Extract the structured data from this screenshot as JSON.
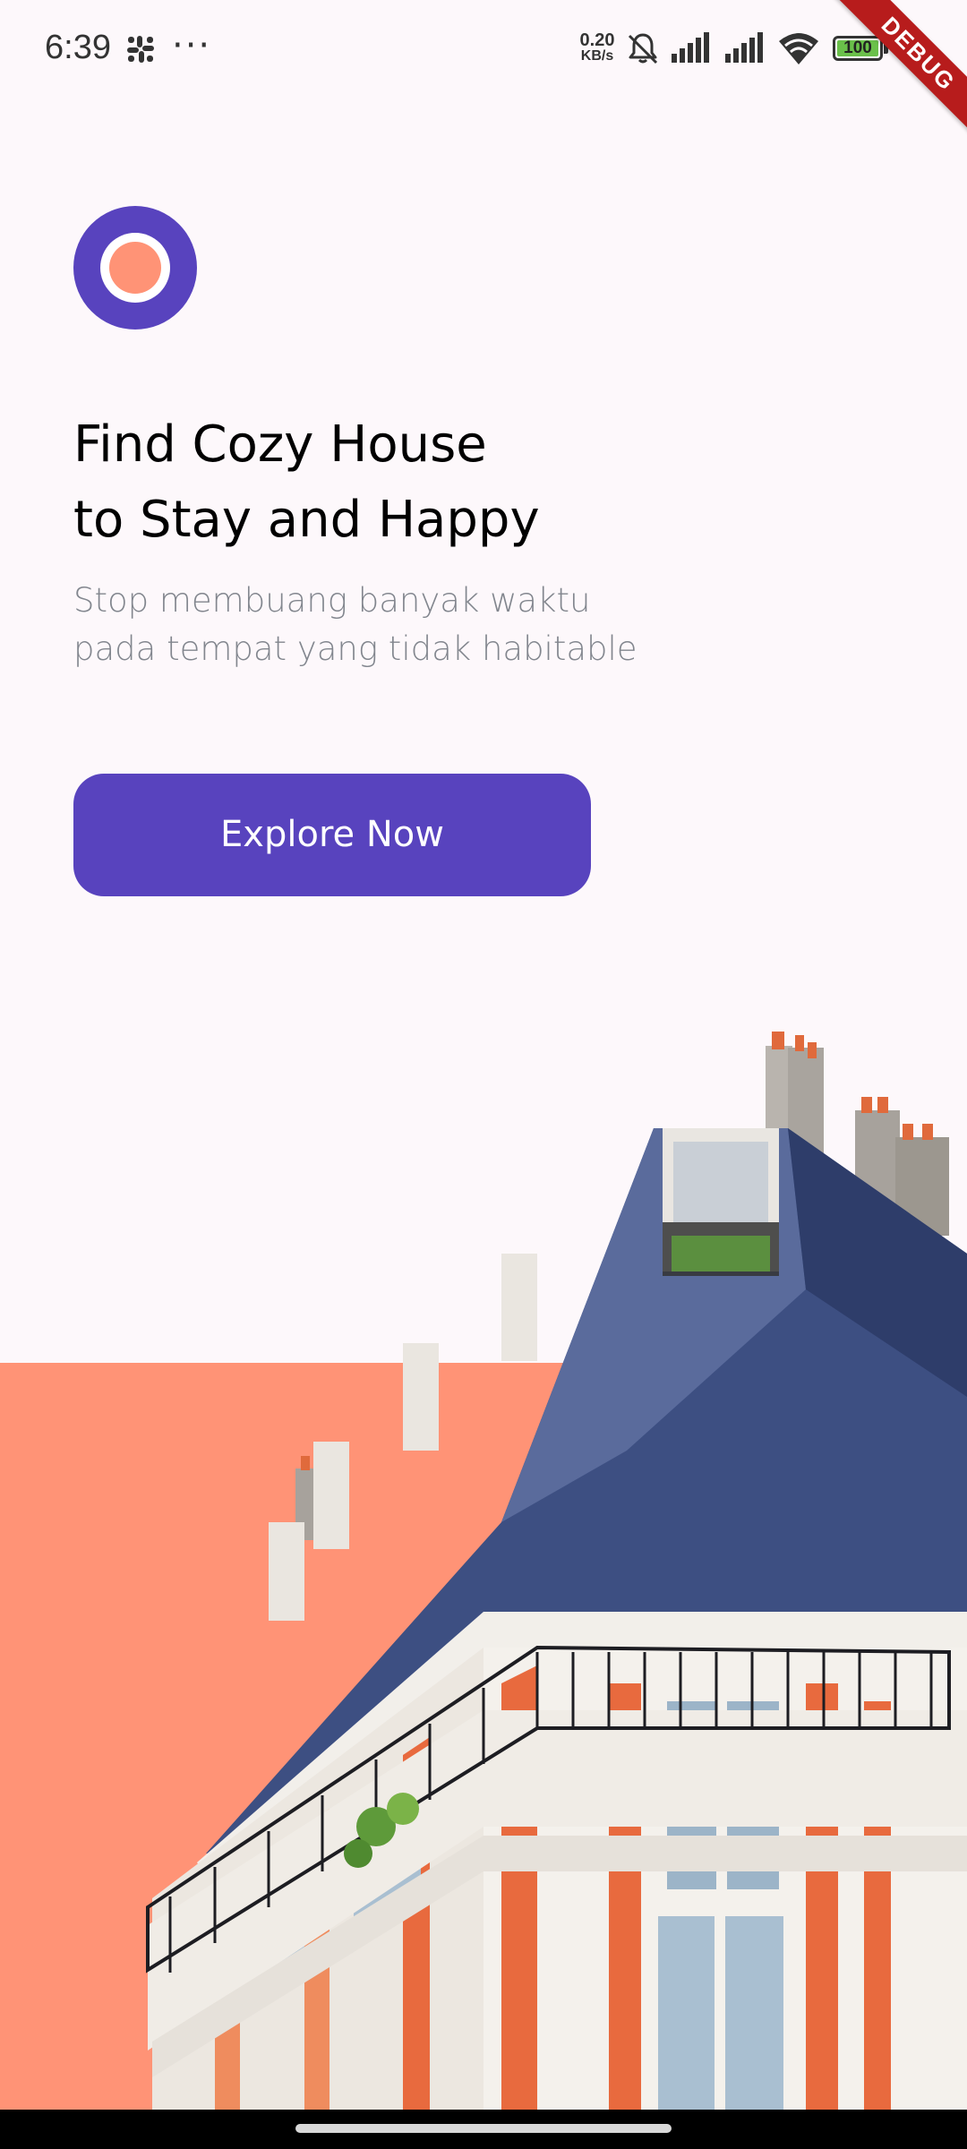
{
  "status_bar": {
    "time": "6:39",
    "more": "···",
    "net_speed_value": "0.20",
    "net_speed_unit": "KB/s",
    "battery_level": "100",
    "icons": [
      "slack-icon",
      "bell-off-icon",
      "signal-icon",
      "signal-icon",
      "wifi-icon",
      "battery-icon"
    ]
  },
  "debug_banner": "DEBUG",
  "hero": {
    "title_line1": "Find Cozy House",
    "title_line2": "to Stay and Happy",
    "subtitle_line1": "Stop membuang banyak waktu",
    "subtitle_line2": "pada tempat yang tidak habitable"
  },
  "cta": {
    "label": "Explore Now"
  },
  "colors": {
    "primary": "#5843BE",
    "accent": "#FF9376",
    "background": "#FDF8FB",
    "subtitle_text": "#82868E"
  }
}
